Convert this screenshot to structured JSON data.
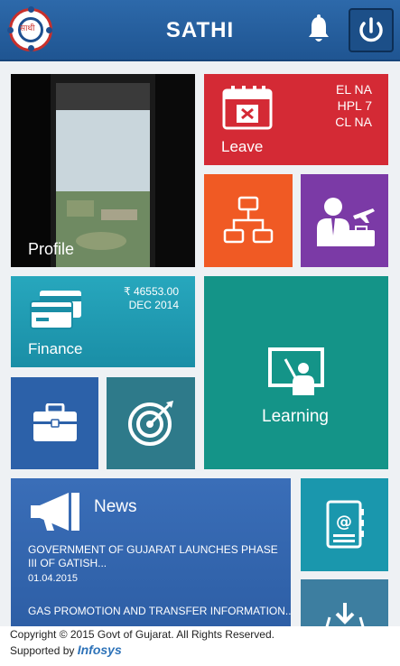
{
  "header": {
    "title": "SATHI",
    "logo_text": "साथी"
  },
  "tiles": {
    "profile": {
      "label": "Profile"
    },
    "leave": {
      "label": "Leave",
      "balances": [
        "EL NA",
        "HPL 7",
        "CL NA"
      ]
    },
    "finance": {
      "label": "Finance",
      "amount": "₹  46553.00",
      "period": "DEC 2014"
    },
    "learning": {
      "label": "Learning"
    },
    "news": {
      "label": "News",
      "items": [
        {
          "title": "GOVERNMENT OF GUJARAT LAUNCHES PHASE III OF GATISH...",
          "date": "01.04.2015"
        },
        {
          "title": "GAS PROMOTION AND TRANSFER INFORMATION...",
          "date": ""
        }
      ]
    }
  },
  "icons": {
    "leave": "calendar-cancel-icon",
    "org": "org-chart-icon",
    "travel": "traveler-icon",
    "finance": "credit-cards-icon",
    "learning": "teacher-board-icon",
    "briefcase": "briefcase-icon",
    "target": "target-icon",
    "news": "megaphone-icon",
    "contacts": "address-book-icon",
    "download": "download-icon"
  },
  "footer": {
    "copyright": "Copyright © 2015 Govt of Gujarat. All Rights Reserved.",
    "supported_by": "Supported by",
    "supporter": "Infosys"
  },
  "colors": {
    "header": "#2a64a6",
    "leave": "#d42a35",
    "org": "#f05a24",
    "travel": "#7b3aa6",
    "finance": "#1f9ab1",
    "learning": "#149488",
    "briefcase": "#2c61a9",
    "target": "#2e7a8a",
    "news": "#3568b2",
    "contacts": "#1a97ad"
  }
}
